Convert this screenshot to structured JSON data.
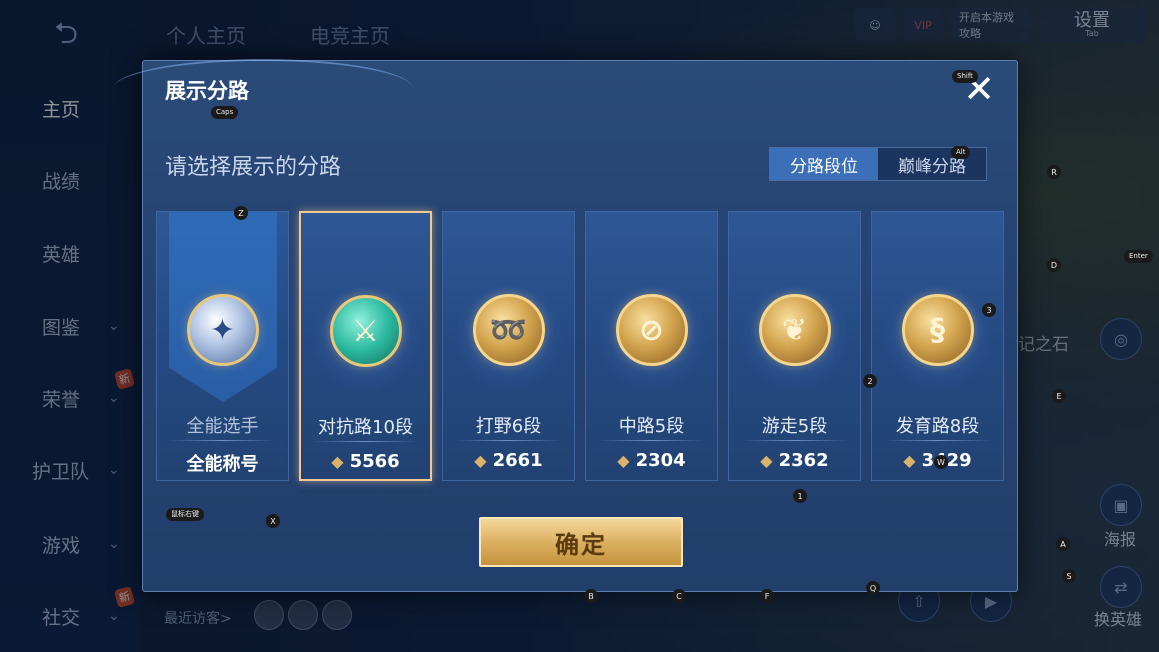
{
  "background": {
    "back_icon": "back-arrow-icon",
    "sidebar": [
      {
        "label": "主页",
        "active": true,
        "chev": false
      },
      {
        "label": "战绩",
        "active": false,
        "chev": false
      },
      {
        "label": "英雄",
        "active": false,
        "chev": false
      },
      {
        "label": "图鉴",
        "active": false,
        "chev": true
      },
      {
        "label": "荣誉",
        "active": false,
        "chev": true,
        "badge": "新"
      },
      {
        "label": "护卫队",
        "active": false,
        "chev": true
      },
      {
        "label": "游戏",
        "active": false,
        "chev": true
      },
      {
        "label": "社交",
        "active": false,
        "chev": true,
        "badge": "新"
      }
    ],
    "chev_glyph": "⌄",
    "top_tabs": [
      "个人主页",
      "电竞主页"
    ],
    "top_right": {
      "vip": "VIP",
      "notice": "开启本游戏攻略",
      "settings": "设置",
      "settings_key": "Tab"
    },
    "visitors_label": "最近访客>",
    "right_text": "记之石",
    "side_buttons": [
      {
        "label": "海报"
      },
      {
        "label": "换英雄"
      }
    ]
  },
  "modal": {
    "title": "展示分路",
    "close_glyph": "✕",
    "subtitle": "请选择展示的分路",
    "toggle": [
      {
        "label": "分路段位",
        "active": true
      },
      {
        "label": "巅峰分路",
        "active": false
      }
    ],
    "cards": [
      {
        "name": "全能选手",
        "value": "全能称号",
        "emblem": "all-round-emblem-icon",
        "glyph": "✦",
        "style": "blue",
        "selected": false,
        "banner": true,
        "show_gem": false
      },
      {
        "name": "对抗路10段",
        "value": "5566",
        "emblem": "clash-lane-emblem-icon",
        "glyph": "⚔",
        "style": "teal",
        "selected": true,
        "banner": false,
        "show_gem": true
      },
      {
        "name": "打野6段",
        "value": "2661",
        "emblem": "jungle-emblem-icon",
        "glyph": "➿",
        "style": "gold",
        "selected": false,
        "banner": false,
        "show_gem": true
      },
      {
        "name": "中路5段",
        "value": "2304",
        "emblem": "mid-lane-emblem-icon",
        "glyph": "⊘",
        "style": "gold",
        "selected": false,
        "banner": false,
        "show_gem": true
      },
      {
        "name": "游走5段",
        "value": "2362",
        "emblem": "roam-emblem-icon",
        "glyph": "❦",
        "style": "gold",
        "selected": false,
        "banner": false,
        "show_gem": true
      },
      {
        "name": "发育路8段",
        "value": "3429",
        "emblem": "farm-lane-emblem-icon",
        "glyph": "§",
        "style": "gold",
        "selected": false,
        "banner": false,
        "show_gem": true
      }
    ],
    "gem_glyph": "◆",
    "confirm_label": "确定"
  },
  "key_hints": [
    {
      "label": "Shift"
    },
    {
      "label": "Caps"
    },
    {
      "label": "Alt"
    },
    {
      "label": "Z"
    },
    {
      "label": "R"
    },
    {
      "label": "Enter"
    },
    {
      "label": "D"
    },
    {
      "label": "3"
    },
    {
      "label": "2"
    },
    {
      "label": "E"
    },
    {
      "label": "W"
    },
    {
      "label": "1"
    },
    {
      "label": "鼠标右键"
    },
    {
      "label": "X"
    },
    {
      "label": "A"
    },
    {
      "label": "S"
    },
    {
      "label": "Q"
    },
    {
      "label": "B"
    },
    {
      "label": "C"
    },
    {
      "label": "F"
    }
  ]
}
